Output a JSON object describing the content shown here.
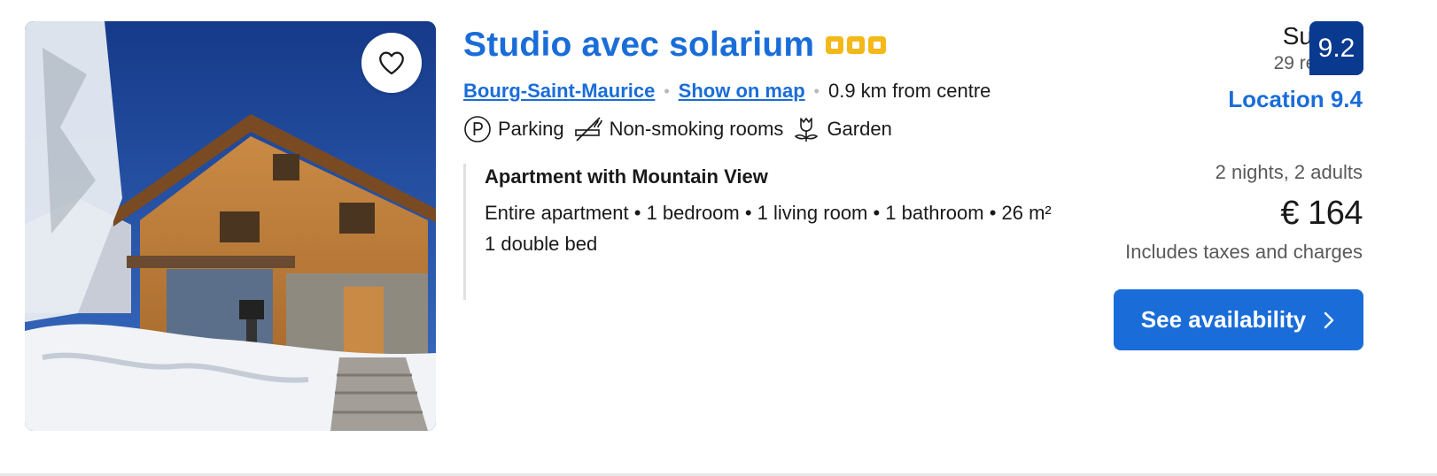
{
  "property": {
    "name": "Studio avec solarium",
    "star_rating": 3,
    "location_link": "Bourg-Saint-Maurice",
    "map_link": "Show on map",
    "distance": "0.9 km from centre",
    "favourite_icon": "heart-icon",
    "photo": "wooden-chalet-snow-photo"
  },
  "facilities": [
    {
      "icon": "parking-icon",
      "label": "Parking"
    },
    {
      "icon": "no-smoking-icon",
      "label": "Non-smoking rooms"
    },
    {
      "icon": "flower-icon",
      "label": "Garden"
    }
  ],
  "unit": {
    "name": "Apartment with Mountain View",
    "details": "Entire apartment • 1 bedroom • 1 living room • 1 bathroom • 26 m²",
    "bed": "1 double bed"
  },
  "review": {
    "word": "Superb",
    "count": "29 reviews",
    "score": "9.2",
    "location_score": "Location 9.4"
  },
  "pricing": {
    "stay": "2 nights, 2 adults",
    "price": "€ 164",
    "note": "Includes taxes and charges"
  },
  "cta": {
    "label": "See availability",
    "icon": "chevron-right-icon"
  },
  "colors": {
    "brand_blue": "#1a6dd8",
    "badge_navy": "#0a3a8f",
    "star_yellow": "#f4b919"
  }
}
